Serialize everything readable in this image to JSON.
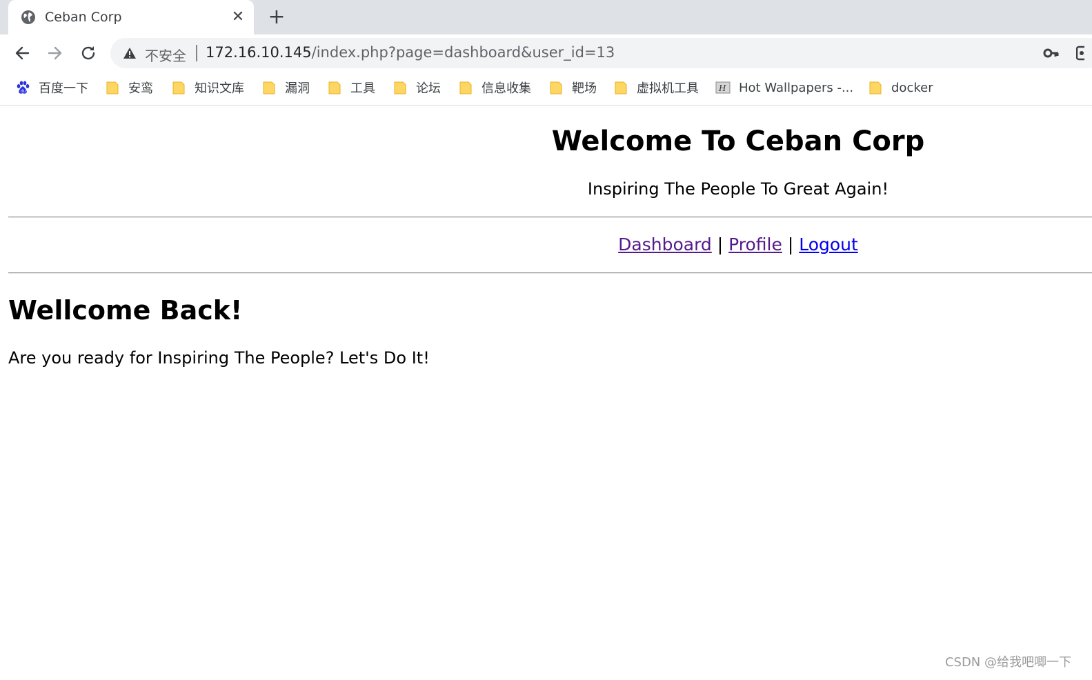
{
  "browser": {
    "tab": {
      "title": "Ceban Corp",
      "close_glyph": "✕",
      "icon": "globe-icon"
    },
    "new_tab_glyph": "+",
    "toolbar": {
      "back_icon": "back-arrow-icon",
      "forward_icon": "forward-arrow-icon",
      "reload_icon": "reload-icon",
      "security_label": "不安全",
      "url_host": "172.16.10.145",
      "url_path": "/index.php?page=dashboard&user_id=13",
      "key_icon": "key-icon"
    },
    "bookmarks": [
      {
        "label": "百度一下",
        "icon": "baidu-paw-icon"
      },
      {
        "label": "安鸾",
        "icon": "folder-icon"
      },
      {
        "label": "知识文库",
        "icon": "folder-icon"
      },
      {
        "label": "漏洞",
        "icon": "folder-icon"
      },
      {
        "label": "工具",
        "icon": "folder-icon"
      },
      {
        "label": "论坛",
        "icon": "folder-icon"
      },
      {
        "label": "信息收集",
        "icon": "folder-icon"
      },
      {
        "label": "靶场",
        "icon": "folder-icon"
      },
      {
        "label": "虚拟机工具",
        "icon": "folder-icon"
      },
      {
        "label": "Hot Wallpapers -...",
        "icon": "site-favicon"
      },
      {
        "label": "docker",
        "icon": "folder-icon"
      }
    ]
  },
  "page": {
    "title": "Welcome To Ceban Corp",
    "tagline": "Inspiring The People To Great Again!",
    "nav": {
      "dashboard": "Dashboard",
      "profile": "Profile",
      "logout": "Logout",
      "separator": "|"
    },
    "heading": "Wellcome Back!",
    "lead": "Are you ready for Inspiring The People? Let's Do It!"
  },
  "watermark": "CSDN @给我吧唧一下",
  "colors": {
    "tabstrip": "#dee1e6",
    "omnibox": "#f1f3f4",
    "link_visited": "#551a8b",
    "link_unvisited": "#0000ee",
    "folder": "#fdd663"
  }
}
